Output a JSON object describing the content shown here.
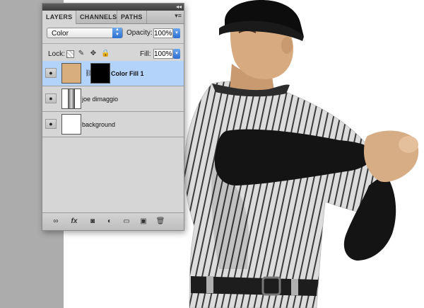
{
  "panel": {
    "tabs": [
      "LAYERS",
      "CHANNELS",
      "PATHS"
    ],
    "active_tab": "LAYERS",
    "blend_mode": "Color",
    "opacity_label": "Opacity:",
    "opacity_value": "100%",
    "lock_label": "Lock:",
    "fill_label": "Fill:",
    "fill_value": "100%"
  },
  "layers": [
    {
      "name": "Color Fill 1",
      "selected": true,
      "visible": true,
      "thumb": "solid-color",
      "mask": true
    },
    {
      "name": "joe dimaggio",
      "selected": false,
      "visible": true,
      "thumb": "photo"
    },
    {
      "name": "background",
      "selected": false,
      "visible": true,
      "thumb": "white"
    }
  ],
  "fill_color": "#d9ae7d",
  "selection_color": "#b3d3fb"
}
